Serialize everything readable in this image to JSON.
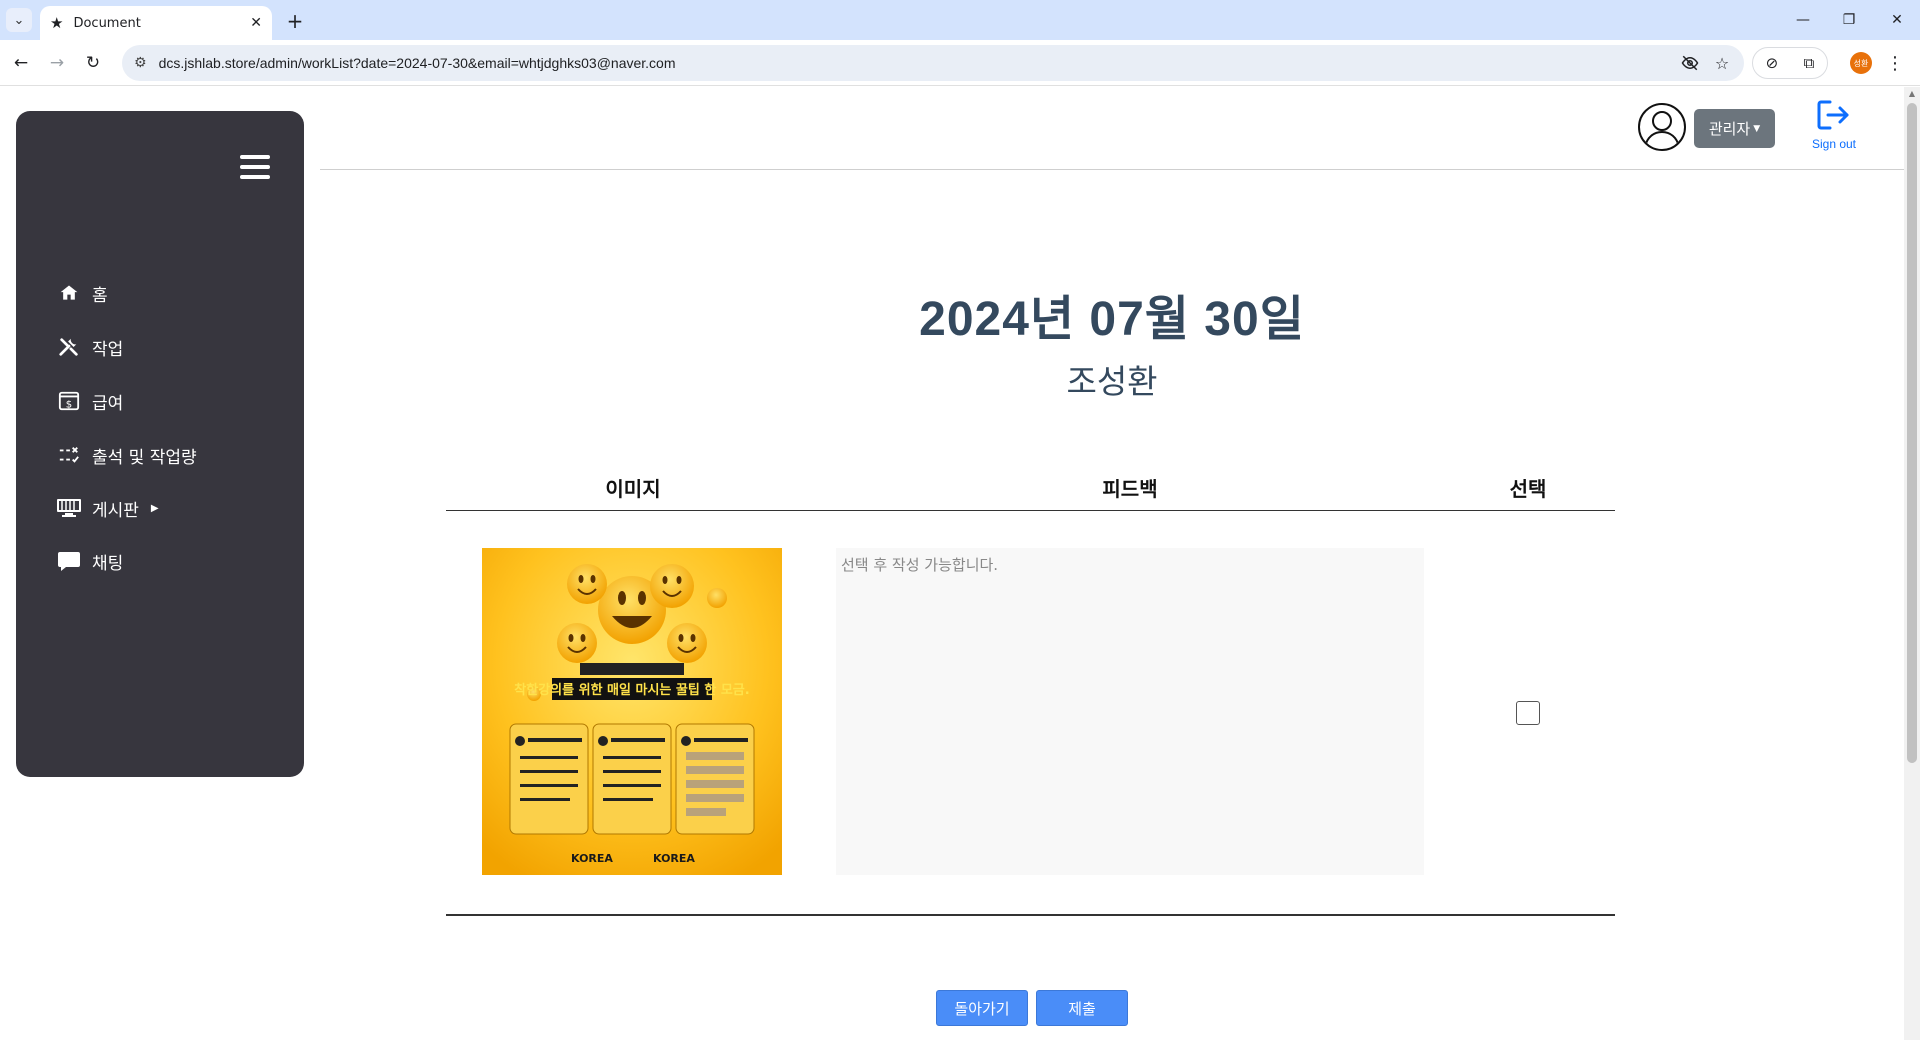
{
  "browser": {
    "tab_title": "Document",
    "url": "dcs.jshlab.store/admin/workList?date=2024-07-30&email=whtjdghks03@naver.com",
    "profile_initials": "성환"
  },
  "sidebar": {
    "items": [
      {
        "label": "홈",
        "icon": "home-icon"
      },
      {
        "label": "작업",
        "icon": "tools-icon"
      },
      {
        "label": "급여",
        "icon": "salary-icon"
      },
      {
        "label": "출석 및 작업량",
        "icon": "checklist-icon"
      },
      {
        "label": "게시판",
        "icon": "board-icon"
      },
      {
        "label": "채팅",
        "icon": "chat-icon"
      }
    ]
  },
  "header": {
    "role_button": "관리자",
    "signout_label": "Sign out"
  },
  "main": {
    "date_title": "2024년 07월 30일",
    "name": "조성환",
    "columns": [
      "이미지",
      "피드백",
      "선택"
    ],
    "feedback_placeholder": "선택 후 작성 가능합니다.",
    "row_checked": false,
    "poster": {
      "headline": "착한강의를 위한 매일 마시는 꿀팁 한 모금.",
      "brand": "KOREA"
    },
    "back_button": "돌아가기",
    "submit_button": "제출"
  },
  "colors": {
    "sidebar_bg": "#37363e",
    "title_color": "#34495e",
    "primary_button": "#4a8df8",
    "role_button_bg": "#6c757d",
    "signout_blue": "#0d6efd"
  }
}
